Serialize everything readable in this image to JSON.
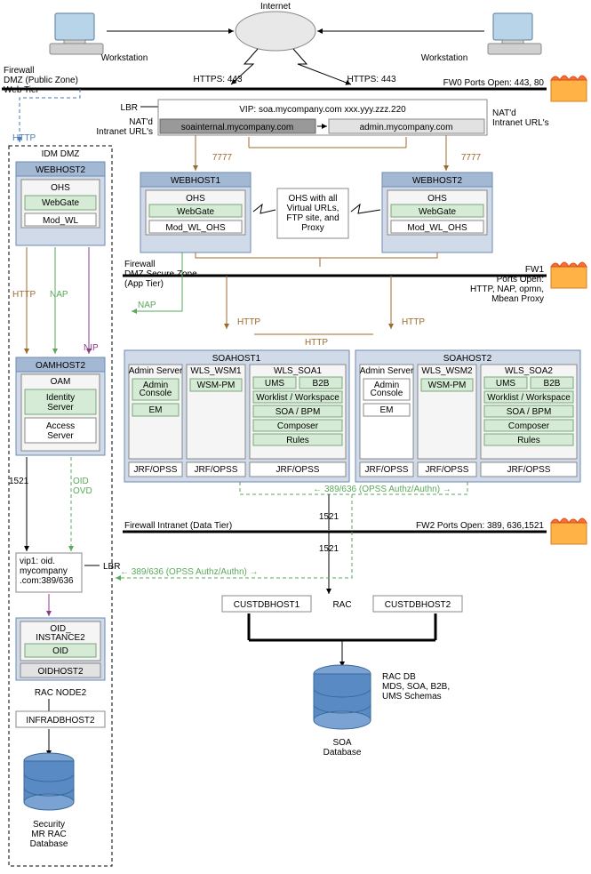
{
  "internet": "Internet",
  "workstationL": "Workstation",
  "workstationR": "Workstation",
  "httpsL": "HTTPS: 443",
  "httpsR": "HTTPS: 443",
  "fw0": {
    "left": "Firewall\nDMZ (Public Zone)\nWeb Tier",
    "right": "FW0 Ports Open: 443, 80"
  },
  "lbr": "LBR",
  "vip": {
    "line": "VIP: soa.mycompany.com    xxx.yyy.zzz.220",
    "left": "soainternal.mycompany.com",
    "right": "admin.mycompany.com"
  },
  "natd_l": "NAT'd\nIntranet URL's",
  "natd_r": "NAT'd\nIntranet URL's",
  "http_l": "HTTP",
  "port7777a": "7777",
  "port7777b": "7777",
  "idm_dmz": "IDM DMZ",
  "webhost2idm": {
    "title": "WEBHOST2",
    "ohs": "OHS",
    "gate": "WebGate",
    "mod": "Mod_WL"
  },
  "webhost1": {
    "title": "WEBHOST1",
    "ohs": "OHS",
    "gate": "WebGate",
    "mod": "Mod_WL_OHS"
  },
  "webhost2": {
    "title": "WEBHOST2",
    "ohs": "OHS",
    "gate": "WebGate",
    "mod": "Mod_WL_OHS"
  },
  "ohs_note": "OHS with all\nVirtual URLs,\nFTP site, and\nProxy",
  "fw1": {
    "left": "Firewall\nDMZ Secure Zone\n(App Tier)",
    "right": "FW1\nPorts Open:\nHTTP, NAP, opmn,\nMbean Proxy"
  },
  "nap": "NAP",
  "http": "HTTP",
  "nip": "NIP",
  "httpA": "HTTP",
  "httpB": "HTTP",
  "napArrow": "NAP",
  "oamhost2": {
    "title": "OAMHOST2",
    "oam": "OAM",
    "id": "Identity\nServer",
    "acc": "Access\nServer"
  },
  "soahost1": {
    "title": "SOAHOST1",
    "admin": "Admin Server",
    "wsm": "WLS_WSM1",
    "soa": "WLS_SOA1",
    "ac": "Admin\nConsole",
    "em": "EM",
    "wsmpm": "WSM-PM",
    "ums": "UMS",
    "b2b": "B2B",
    "wl": "Worklist / Workspace",
    "soabpm": "SOA / BPM",
    "comp": "Composer",
    "rules": "Rules",
    "jrf": "JRF/OPSS"
  },
  "soahost2": {
    "title": "SOAHOST2",
    "admin": "Admin Server",
    "wsm": "WLS_WSM2",
    "soa": "WLS_SOA2",
    "ac": "Admin\nConsole",
    "em": "EM",
    "wsmpm": "WSM-PM",
    "ums": "UMS",
    "b2b": "B2B",
    "wl": "Worklist / Workspace",
    "soabpm": "SOA / BPM",
    "comp": "Composer",
    "rules": "Rules",
    "jrf": "JRF/OPSS"
  },
  "p1521a": "1521",
  "oidovd": "OID\nOVD",
  "opss": "389/636 (OPSS Authz/Authn)",
  "fw2": {
    "left": "Firewall Intranet (Data Tier)",
    "right": "FW2 Ports Open: 389, 636,1521"
  },
  "p1521b": "1521",
  "p1521c": "1521",
  "vip1": "vip1: oid.\nmycompany\n.com:389/636",
  "lbr2": "LBR",
  "opss2": "389/636 (OPSS Authz/Authn)",
  "oidinst": {
    "title": "OID_\nINSTANCE2",
    "oid": "OID",
    "host": "OIDHOST2"
  },
  "racnode": "RAC NODE2",
  "infradb": "INFRADBHOST2",
  "custdb1": "CUSTDBHOST1",
  "custdb2": "CUSTDBHOST2",
  "rac": "RAC",
  "racdb": "RAC DB\nMDS, SOA, B2B,\nUMS Schemas",
  "soadb": "SOA\nDatabase",
  "secdb": "Security\nMR RAC\nDatabase"
}
